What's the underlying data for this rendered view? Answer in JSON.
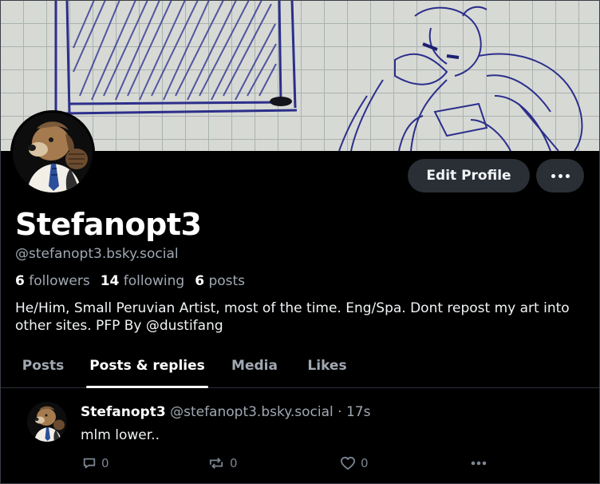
{
  "profile": {
    "display_name": "Stefanopt3",
    "handle": "@stefanopt3.bsky.social",
    "stats": {
      "followers_count": "6",
      "followers_label": "followers",
      "following_count": "14",
      "following_label": "following",
      "posts_count": "6",
      "posts_label": "posts"
    },
    "bio": "He/Him, Small Peruvian Artist, most of the time. Eng/Spa. Dont repost my art into other sites. PFP By @dustifang"
  },
  "header": {
    "edit_profile_label": "Edit Profile",
    "more_icon": "ellipsis-icon"
  },
  "tabs": [
    {
      "label": "Posts",
      "active": false
    },
    {
      "label": "Posts & replies",
      "active": true
    },
    {
      "label": "Media",
      "active": false
    },
    {
      "label": "Likes",
      "active": false
    }
  ],
  "post": {
    "author": "Stefanopt3",
    "handle": "@stefanopt3.bsky.social",
    "separator": "·",
    "time": "17s",
    "text": "mlm lower..",
    "reply_count": "0",
    "repost_count": "0",
    "like_count": "0"
  },
  "colors": {
    "background": "#000000",
    "button_bg": "#2a2f36",
    "muted_text": "#a0a8b2",
    "sketch_ink": "#2c2f8a"
  }
}
